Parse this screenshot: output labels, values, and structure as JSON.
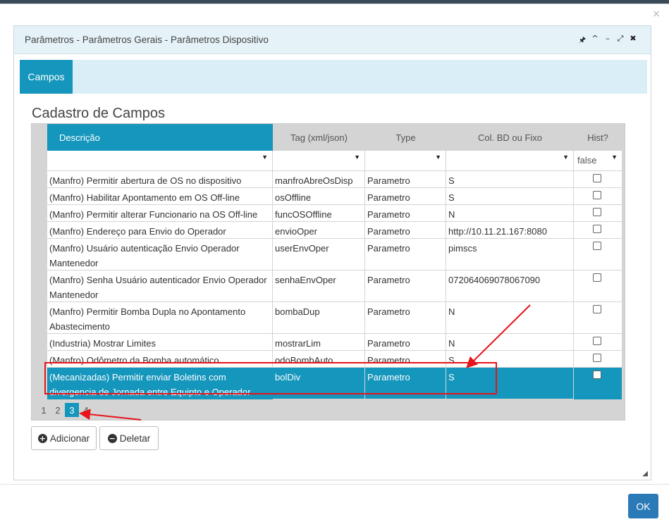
{
  "dialog": {
    "close_glyph": "×",
    "title": "Parâmetros - Parâmetros Gerais - Parâmetros Dispositivo",
    "controls": [
      "🖈",
      "^",
      "–",
      "⤢",
      "✖"
    ]
  },
  "tabs": [
    {
      "label": "Campos",
      "active": true
    }
  ],
  "section_title": "Cadastro de Campos",
  "grid": {
    "columns": [
      "Descrição",
      "Tag (xml/json)",
      "Type",
      "Col. BD ou Fixo",
      "Hist?"
    ],
    "hist_filter_value": "false",
    "filter_dropdown_glyph": "▼",
    "rows": [
      {
        "descricao": "(Manfro) Permitir abertura de OS no dispositivo",
        "tag": "manfroAbreOsDisp",
        "type": "Parametro",
        "col": "S",
        "hist": false
      },
      {
        "descricao": "(Manfro) Habilitar Apontamento em OS Off-line",
        "tag": "osOffline",
        "type": "Parametro",
        "col": "S",
        "hist": false
      },
      {
        "descricao": "(Manfro) Permitir alterar Funcionario na OS Off-line",
        "tag": "funcOSOffline",
        "type": "Parametro",
        "col": "N",
        "hist": false
      },
      {
        "descricao": "(Manfro) Endereço para Envio do Operador Mantenedor",
        "tag": "envioOper",
        "type": "Parametro",
        "col": "http://10.11.21.167:8080",
        "hist": false
      },
      {
        "descricao": "(Manfro) Usuário autenticação Envio Operador Mantenedor",
        "tag": "userEnvOper",
        "type": "Parametro",
        "col": "pimscs",
        "hist": false
      },
      {
        "descricao": "(Manfro) Senha Usuário autenticador Envio Operador Mantenedor",
        "tag": "senhaEnvOper",
        "type": "Parametro",
        "col": "072064069078067090",
        "hist": false
      },
      {
        "descricao": "(Manfro) Permitir Bomba Dupla no Apontamento Abastecimento",
        "tag": "bombaDup",
        "type": "Parametro",
        "col": "N",
        "hist": false
      },
      {
        "descricao": "(Industria) Mostrar Limites",
        "tag": "mostrarLim",
        "type": "Parametro",
        "col": "N",
        "hist": false
      },
      {
        "descricao": "(Manfro) Odômetro da Bomba automático",
        "tag": "odoBombAuto",
        "type": "Parametro",
        "col": "S",
        "hist": false
      },
      {
        "descricao": "(Mecanizadas) Permitir enviar Boletins com divergencia de Jornada entre Equipto e Operador",
        "tag": "bolDiv",
        "type": "Parametro",
        "col": "S",
        "hist": false,
        "selected": true
      }
    ]
  },
  "pager": {
    "pages": [
      "1",
      "2",
      "3",
      "4"
    ],
    "current": "3"
  },
  "buttons": {
    "add": {
      "icon": "+",
      "label": "Adicionar"
    },
    "delete": {
      "icon": "−",
      "label": "Deletar"
    }
  },
  "resize_glyph": "◢",
  "ok_label": "OK",
  "colors": {
    "accent": "#1596bc",
    "header_bg": "#e5f2f7",
    "ok": "#2a7ab8",
    "annotation": "#e8131b"
  }
}
